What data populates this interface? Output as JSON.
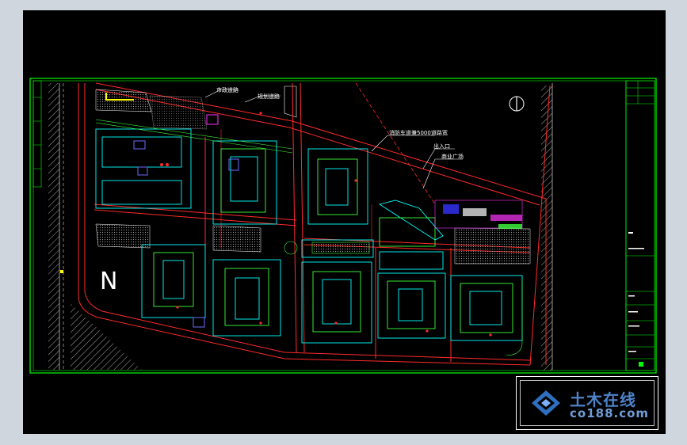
{
  "drawing": {
    "north_letter": "N",
    "annotations": [
      {
        "id": "label-road-a",
        "text": "市政道路"
      },
      {
        "id": "label-road-b",
        "text": "规划道路"
      },
      {
        "id": "label-fire-lane",
        "text": "消防车道兼5000道路宽"
      },
      {
        "id": "label-entrance",
        "text": "出入口"
      },
      {
        "id": "label-plaza",
        "text": "商业广场"
      }
    ],
    "colors": {
      "background": "#000000",
      "frame": "#00ff00",
      "road": "#ff2a2a",
      "building": "#00ffff",
      "landscape": "#3cff3c",
      "paving": "#9a9a9a",
      "highlight": "#ffff00"
    }
  },
  "watermark": {
    "brand": "土木在线",
    "domain": "co188.com"
  }
}
